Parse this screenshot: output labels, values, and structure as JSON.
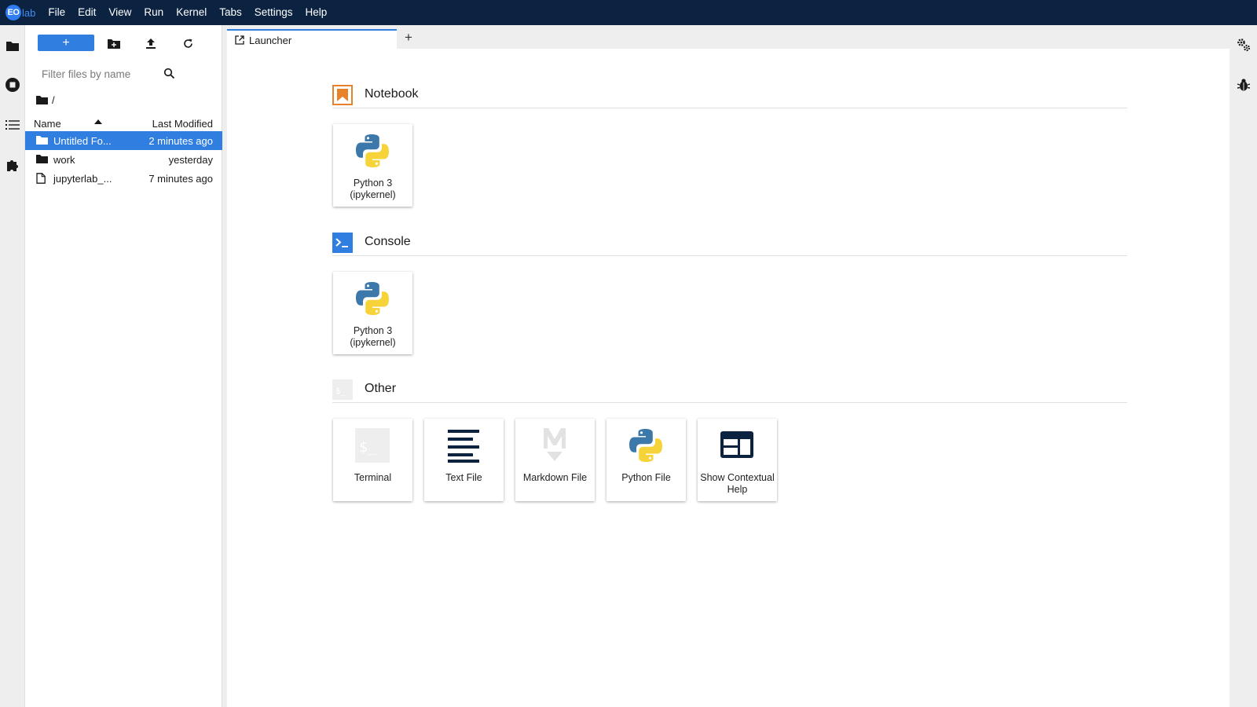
{
  "menubar": {
    "logo_eo": "EO",
    "logo_lab": "lab",
    "items": [
      "File",
      "Edit",
      "View",
      "Run",
      "Kernel",
      "Tabs",
      "Settings",
      "Help"
    ]
  },
  "filebrowser": {
    "new_button_label": "+",
    "filter_placeholder": "Filter files by name",
    "breadcrumb": "/",
    "header_name": "Name",
    "header_modified": "Last Modified",
    "rows": [
      {
        "name": "Untitled Fo...",
        "modified": "2 minutes ago",
        "type": "folder",
        "selected": true
      },
      {
        "name": "work",
        "modified": "yesterday",
        "type": "folder",
        "selected": false
      },
      {
        "name": "jupyterlab_...",
        "modified": "7 minutes ago",
        "type": "file",
        "selected": false
      }
    ]
  },
  "tabs": [
    {
      "label": "Launcher",
      "icon": "launch-icon"
    }
  ],
  "launcher": {
    "sections": [
      {
        "title": "Notebook",
        "icon": "notebook-icon",
        "cards": [
          {
            "label": "Python 3 (ipykernel)",
            "icon": "python-icon"
          }
        ]
      },
      {
        "title": "Console",
        "icon": "console-icon",
        "cards": [
          {
            "label": "Python 3 (ipykernel)",
            "icon": "python-icon"
          }
        ]
      },
      {
        "title": "Other",
        "icon": "terminal-icon",
        "cards": [
          {
            "label": "Terminal",
            "icon": "terminal-icon"
          },
          {
            "label": "Text File",
            "icon": "text-file-icon"
          },
          {
            "label": "Markdown File",
            "icon": "markdown-icon"
          },
          {
            "label": "Python File",
            "icon": "python-icon"
          },
          {
            "label": "Show Contextual Help",
            "icon": "contextual-help-icon"
          }
        ]
      }
    ]
  },
  "colors": {
    "menubar_bg": "#0b2240",
    "accent": "#2f7ee0",
    "notebook_orange": "#e8822a"
  }
}
